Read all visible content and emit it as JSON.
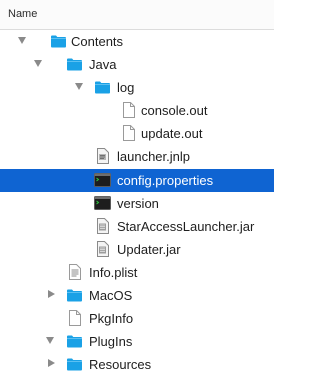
{
  "header": {
    "column_name": "Name"
  },
  "tree": [
    {
      "label": "Contents",
      "icon": "folder-icon",
      "disclosure": "expanded"
    },
    {
      "label": "Java",
      "icon": "folder-icon",
      "disclosure": "expanded"
    },
    {
      "label": "log",
      "icon": "folder-icon",
      "disclosure": "expanded"
    },
    {
      "label": "console.out",
      "icon": "document-icon",
      "disclosure": "none"
    },
    {
      "label": "update.out",
      "icon": "document-icon",
      "disclosure": "none"
    },
    {
      "label": "launcher.jnlp",
      "icon": "jnlp-file-icon",
      "disclosure": "none"
    },
    {
      "label": "config.properties",
      "icon": "terminal-file-icon",
      "disclosure": "none",
      "selected": true
    },
    {
      "label": "version",
      "icon": "terminal-file-icon",
      "disclosure": "none"
    },
    {
      "label": "StarAccessLauncher.jar",
      "icon": "jar-file-icon",
      "disclosure": "none"
    },
    {
      "label": "Updater.jar",
      "icon": "jar-file-icon",
      "disclosure": "none"
    },
    {
      "label": "Info.plist",
      "icon": "plist-file-icon",
      "disclosure": "none"
    },
    {
      "label": "MacOS",
      "icon": "folder-icon",
      "disclosure": "collapsed"
    },
    {
      "label": "PkgInfo",
      "icon": "document-icon",
      "disclosure": "none"
    },
    {
      "label": "PlugIns",
      "icon": "folder-icon",
      "disclosure": "expanded"
    },
    {
      "label": "Resources",
      "icon": "folder-icon",
      "disclosure": "collapsed"
    }
  ],
  "colors": {
    "selection": "#0f64d2",
    "folder": "#1aa1e6"
  }
}
